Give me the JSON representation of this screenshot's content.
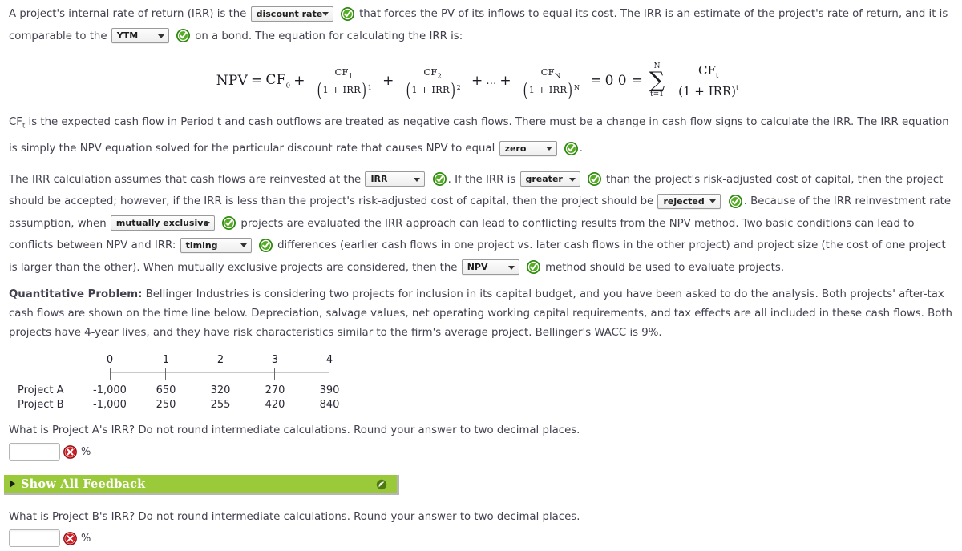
{
  "intro": {
    "p1_a": "A project's internal rate of return (IRR) is the",
    "dd_discount": "discount rate",
    "p1_b": "that forces the PV of its inflows to equal its cost. The IRR is an estimate of the project's rate of return, and it is comparable to the",
    "dd_ytm": "YTM",
    "p1_c": "on a bond. The equation for calculating the IRR is:"
  },
  "equation": {
    "npv_label": "NPV",
    "equals": "=",
    "cf0": "CF",
    "cf0_sub": "0",
    "plus": "+",
    "cf1": "CF",
    "cf1_sub": "1",
    "den1": "1 + IRR",
    "den1_sup": "1",
    "cf2": "CF",
    "cf2_sub": "2",
    "den2": "1 + IRR",
    "den2_sup": "2",
    "ellipsis": "...",
    "cfn": "CF",
    "cfn_sub": "N",
    "denn": "1 + IRR",
    "denn_sup": "N",
    "zero": "0",
    "line2_zero": "0",
    "sigma_top": "N",
    "sigma_glyph": "∑",
    "sigma_bottom": "t=1",
    "cft": "CF",
    "cft_sub": "t",
    "dent": "(1 + IRR)",
    "dent_sup": "t"
  },
  "para2": {
    "a": "CF",
    "a_sub": "t",
    "b": "is the expected cash flow in Period t and cash outflows are treated as negative cash flows. There must be a change in cash flow signs to calculate the IRR. The IRR equation is simply the NPV equation solved for the particular discount rate that causes NPV to equal",
    "dd_zero": "zero",
    "c": "."
  },
  "para3": {
    "a": "The IRR calculation assumes that cash flows are reinvested at the",
    "dd_irr": "IRR",
    "b": ". If the IRR is",
    "dd_greater": "greater",
    "c": "than the project's risk-adjusted cost of capital, then the project should be accepted; however, if the IRR is less than the project's risk-adjusted cost of capital, then the project should be",
    "dd_rejected": "rejected",
    "d": ". Because of the IRR reinvestment rate assumption, when",
    "dd_mutex": "mutually exclusive",
    "e": "projects are evaluated the IRR approach can lead to conflicting results from the NPV method. Two basic conditions can lead to conflicts between NPV and IRR:",
    "dd_timing": "timing",
    "f": "differences (earlier cash flows in one project vs. later cash flows in the other project) and project size (the cost of one project is larger than the other). When mutually exclusive projects are considered, then the",
    "dd_npv": "NPV",
    "g": "method should be used to evaluate projects."
  },
  "quant": {
    "label": "Quantitative Problem:",
    "text": "Bellinger Industries is considering two projects for inclusion in its capital budget, and you have been asked to do the analysis. Both projects' after-tax cash flows are shown on the time line below. Depreciation, salvage values, net operating working capital requirements, and tax effects are all included in these cash flows. Both projects have 4-year lives, and they have risk characteristics similar to the firm's average project. Bellinger's WACC is 9%."
  },
  "timeline": {
    "periods": [
      "0",
      "1",
      "2",
      "3",
      "4"
    ],
    "rows": [
      {
        "label": "Project A",
        "values": [
          "-1,000",
          "650",
          "320",
          "270",
          "390"
        ]
      },
      {
        "label": "Project B",
        "values": [
          "-1,000",
          "250",
          "255",
          "420",
          "840"
        ]
      }
    ]
  },
  "questions": [
    {
      "prompt": "What is Project A's IRR? Do not round intermediate calculations. Round your answer to two decimal places.",
      "value": "",
      "placeholder": "",
      "unit": "%",
      "status_icon": "red-x-icon"
    },
    {
      "prompt": "What is Project B's IRR? Do not round intermediate calculations. Round your answer to two decimal places.",
      "value": "",
      "placeholder": "",
      "unit": "%",
      "status_icon": "red-x-icon"
    }
  ],
  "feedback": {
    "label": "Show All Feedback",
    "bar_color": "#9ac93a",
    "text_color": "#ffffff",
    "caret_icon": "triangle-right-icon",
    "right_icon": "feedback-circle-icon"
  },
  "icons": {
    "check": "green-check-circle-icon",
    "cross": "red-x-circle-icon",
    "chevron": "chevron-down-icon"
  },
  "colors": {
    "check_green": "#3f9c1f",
    "cross_red": "#c3161c",
    "feedback_green": "#9ac93a",
    "text": "#42424f"
  }
}
